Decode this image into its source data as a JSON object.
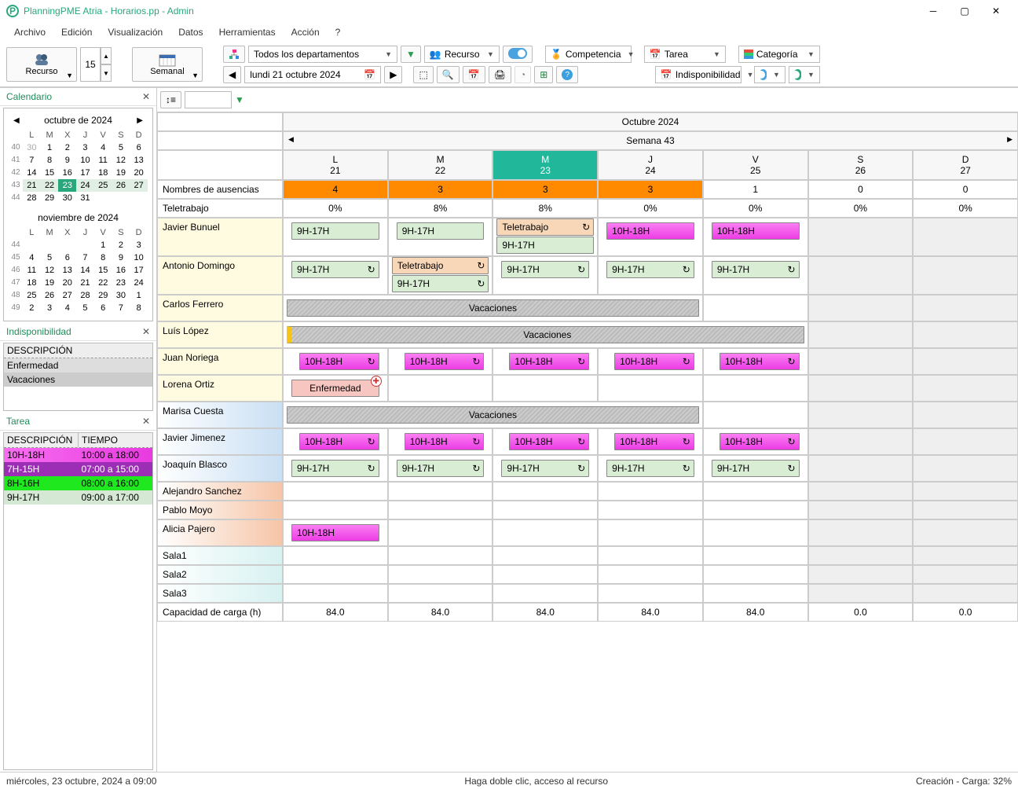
{
  "title": "PlanningPME Atria - Horarios.pp - Admin",
  "menu": [
    "Archivo",
    "Edición",
    "Visualización",
    "Datos",
    "Herramientas",
    "Acción",
    "?"
  ],
  "toolbar": {
    "resource_label": "Recurso",
    "spin_value": "15",
    "weekly_label": "Semanal",
    "dept_select": "Todos los departamentos",
    "recurso_select": "Recurso",
    "competencia_select": "Competencia",
    "tarea_select": "Tarea",
    "categoria_select": "Categoría",
    "indispo_select": "Indisponibilidad",
    "date_display": "lundi    21   octubre    2024"
  },
  "sidebar": {
    "cal_title": "Calendario",
    "oct_label": "octubre de 2024",
    "nov_label": "noviembre de 2024",
    "day_hdrs": [
      "L",
      "M",
      "X",
      "J",
      "V",
      "S",
      "D"
    ],
    "oct_weeks": [
      {
        "wk": "40",
        "days": [
          "30",
          "1",
          "2",
          "3",
          "4",
          "5",
          "6"
        ]
      },
      {
        "wk": "41",
        "days": [
          "7",
          "8",
          "9",
          "10",
          "11",
          "12",
          "13"
        ]
      },
      {
        "wk": "42",
        "days": [
          "14",
          "15",
          "16",
          "17",
          "18",
          "19",
          "20"
        ]
      },
      {
        "wk": "43",
        "days": [
          "21",
          "22",
          "23",
          "24",
          "25",
          "26",
          "27"
        ]
      },
      {
        "wk": "44",
        "days": [
          "28",
          "29",
          "30",
          "31",
          "",
          "",
          ""
        ]
      }
    ],
    "nov_weeks": [
      {
        "wk": "44",
        "days": [
          "",
          "",
          "",
          "",
          "1",
          "2",
          "3"
        ]
      },
      {
        "wk": "45",
        "days": [
          "4",
          "5",
          "6",
          "7",
          "8",
          "9",
          "10"
        ]
      },
      {
        "wk": "46",
        "days": [
          "11",
          "12",
          "13",
          "14",
          "15",
          "16",
          "17"
        ]
      },
      {
        "wk": "47",
        "days": [
          "18",
          "19",
          "20",
          "21",
          "22",
          "23",
          "24"
        ]
      },
      {
        "wk": "48",
        "days": [
          "25",
          "26",
          "27",
          "28",
          "29",
          "30",
          "1"
        ]
      },
      {
        "wk": "49",
        "days": [
          "2",
          "3",
          "4",
          "5",
          "6",
          "7",
          "8"
        ]
      }
    ],
    "indispo_title": "Indisponibilidad",
    "indispo_hdr": "DESCRIPCIÓN",
    "indispo_items": [
      "Enfermedad",
      "Vacaciones"
    ],
    "tarea_title": "Tarea",
    "tarea_hdrs": [
      "DESCRIPCIÓN",
      "TIEMPO"
    ],
    "tarea_items": [
      {
        "desc": "10H-18H",
        "time": "10:00 a 18:00",
        "cls": "task-row-magenta"
      },
      {
        "desc": "7H-15H",
        "time": "07:00 a 15:00",
        "cls": "task-row-purple"
      },
      {
        "desc": "8H-16H",
        "time": "08:00 a 16:00",
        "cls": "task-row-green-b"
      },
      {
        "desc": "9H-17H",
        "time": "09:00 a 17:00",
        "cls": "task-row-green-l"
      }
    ]
  },
  "timeline": {
    "month": "Octubre 2024",
    "week": "Semana 43",
    "days": [
      {
        "dow": "L",
        "num": "21"
      },
      {
        "dow": "M",
        "num": "22"
      },
      {
        "dow": "M",
        "num": "23"
      },
      {
        "dow": "J",
        "num": "24"
      },
      {
        "dow": "V",
        "num": "25"
      },
      {
        "dow": "S",
        "num": "26"
      },
      {
        "dow": "D",
        "num": "27"
      }
    ],
    "absence_label": "Nombres de ausencias",
    "absence_vals": [
      "4",
      "3",
      "3",
      "3",
      "1",
      "0",
      "0"
    ],
    "telework_label": "Teletrabajo",
    "telework_vals": [
      "0%",
      "8%",
      "8%",
      "0%",
      "0%",
      "0%",
      "0%"
    ],
    "capacity_label": "Capacidad de carga (h)",
    "capacity_vals": [
      "84.0",
      "84.0",
      "84.0",
      "84.0",
      "84.0",
      "0.0",
      "0.0"
    ],
    "vacaciones": "Vacaciones",
    "enfermedad": "Enfermedad",
    "teletrabajo": "Teletrabajo",
    "s9": "9H-17H",
    "s10": "10H-18H",
    "resources": [
      "Javier Bunuel",
      "Antonio Domingo",
      "Carlos Ferrero",
      "Luís López",
      "Juan Noriega",
      "Lorena Ortiz",
      "Marisa Cuesta",
      "Javier Jimenez",
      "Joaquín Blasco",
      "Alejandro Sanchez",
      "Pablo Moyo",
      "Alicia Pajero",
      "Sala1",
      "Sala2",
      "Sala3"
    ]
  },
  "statusbar": {
    "left": "miércoles, 23 octubre, 2024 a 09:00",
    "mid": "Haga doble clic, acceso al recurso",
    "right": "Creación - Carga: 32%"
  }
}
